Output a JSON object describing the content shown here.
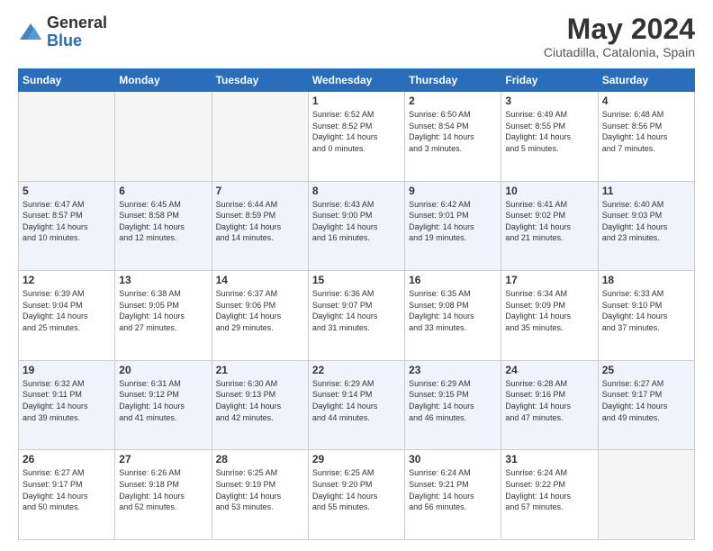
{
  "header": {
    "logo_general": "General",
    "logo_blue": "Blue",
    "month_title": "May 2024",
    "location": "Ciutadilla, Catalonia, Spain"
  },
  "calendar": {
    "days_of_week": [
      "Sunday",
      "Monday",
      "Tuesday",
      "Wednesday",
      "Thursday",
      "Friday",
      "Saturday"
    ],
    "rows": [
      [
        {
          "day": "",
          "info": ""
        },
        {
          "day": "",
          "info": ""
        },
        {
          "day": "",
          "info": ""
        },
        {
          "day": "1",
          "info": "Sunrise: 6:52 AM\nSunset: 8:52 PM\nDaylight: 14 hours\nand 0 minutes."
        },
        {
          "day": "2",
          "info": "Sunrise: 6:50 AM\nSunset: 8:54 PM\nDaylight: 14 hours\nand 3 minutes."
        },
        {
          "day": "3",
          "info": "Sunrise: 6:49 AM\nSunset: 8:55 PM\nDaylight: 14 hours\nand 5 minutes."
        },
        {
          "day": "4",
          "info": "Sunrise: 6:48 AM\nSunset: 8:56 PM\nDaylight: 14 hours\nand 7 minutes."
        }
      ],
      [
        {
          "day": "5",
          "info": "Sunrise: 6:47 AM\nSunset: 8:57 PM\nDaylight: 14 hours\nand 10 minutes."
        },
        {
          "day": "6",
          "info": "Sunrise: 6:45 AM\nSunset: 8:58 PM\nDaylight: 14 hours\nand 12 minutes."
        },
        {
          "day": "7",
          "info": "Sunrise: 6:44 AM\nSunset: 8:59 PM\nDaylight: 14 hours\nand 14 minutes."
        },
        {
          "day": "8",
          "info": "Sunrise: 6:43 AM\nSunset: 9:00 PM\nDaylight: 14 hours\nand 16 minutes."
        },
        {
          "day": "9",
          "info": "Sunrise: 6:42 AM\nSunset: 9:01 PM\nDaylight: 14 hours\nand 19 minutes."
        },
        {
          "day": "10",
          "info": "Sunrise: 6:41 AM\nSunset: 9:02 PM\nDaylight: 14 hours\nand 21 minutes."
        },
        {
          "day": "11",
          "info": "Sunrise: 6:40 AM\nSunset: 9:03 PM\nDaylight: 14 hours\nand 23 minutes."
        }
      ],
      [
        {
          "day": "12",
          "info": "Sunrise: 6:39 AM\nSunset: 9:04 PM\nDaylight: 14 hours\nand 25 minutes."
        },
        {
          "day": "13",
          "info": "Sunrise: 6:38 AM\nSunset: 9:05 PM\nDaylight: 14 hours\nand 27 minutes."
        },
        {
          "day": "14",
          "info": "Sunrise: 6:37 AM\nSunset: 9:06 PM\nDaylight: 14 hours\nand 29 minutes."
        },
        {
          "day": "15",
          "info": "Sunrise: 6:36 AM\nSunset: 9:07 PM\nDaylight: 14 hours\nand 31 minutes."
        },
        {
          "day": "16",
          "info": "Sunrise: 6:35 AM\nSunset: 9:08 PM\nDaylight: 14 hours\nand 33 minutes."
        },
        {
          "day": "17",
          "info": "Sunrise: 6:34 AM\nSunset: 9:09 PM\nDaylight: 14 hours\nand 35 minutes."
        },
        {
          "day": "18",
          "info": "Sunrise: 6:33 AM\nSunset: 9:10 PM\nDaylight: 14 hours\nand 37 minutes."
        }
      ],
      [
        {
          "day": "19",
          "info": "Sunrise: 6:32 AM\nSunset: 9:11 PM\nDaylight: 14 hours\nand 39 minutes."
        },
        {
          "day": "20",
          "info": "Sunrise: 6:31 AM\nSunset: 9:12 PM\nDaylight: 14 hours\nand 41 minutes."
        },
        {
          "day": "21",
          "info": "Sunrise: 6:30 AM\nSunset: 9:13 PM\nDaylight: 14 hours\nand 42 minutes."
        },
        {
          "day": "22",
          "info": "Sunrise: 6:29 AM\nSunset: 9:14 PM\nDaylight: 14 hours\nand 44 minutes."
        },
        {
          "day": "23",
          "info": "Sunrise: 6:29 AM\nSunset: 9:15 PM\nDaylight: 14 hours\nand 46 minutes."
        },
        {
          "day": "24",
          "info": "Sunrise: 6:28 AM\nSunset: 9:16 PM\nDaylight: 14 hours\nand 47 minutes."
        },
        {
          "day": "25",
          "info": "Sunrise: 6:27 AM\nSunset: 9:17 PM\nDaylight: 14 hours\nand 49 minutes."
        }
      ],
      [
        {
          "day": "26",
          "info": "Sunrise: 6:27 AM\nSunset: 9:17 PM\nDaylight: 14 hours\nand 50 minutes."
        },
        {
          "day": "27",
          "info": "Sunrise: 6:26 AM\nSunset: 9:18 PM\nDaylight: 14 hours\nand 52 minutes."
        },
        {
          "day": "28",
          "info": "Sunrise: 6:25 AM\nSunset: 9:19 PM\nDaylight: 14 hours\nand 53 minutes."
        },
        {
          "day": "29",
          "info": "Sunrise: 6:25 AM\nSunset: 9:20 PM\nDaylight: 14 hours\nand 55 minutes."
        },
        {
          "day": "30",
          "info": "Sunrise: 6:24 AM\nSunset: 9:21 PM\nDaylight: 14 hours\nand 56 minutes."
        },
        {
          "day": "31",
          "info": "Sunrise: 6:24 AM\nSunset: 9:22 PM\nDaylight: 14 hours\nand 57 minutes."
        },
        {
          "day": "",
          "info": ""
        }
      ]
    ]
  }
}
